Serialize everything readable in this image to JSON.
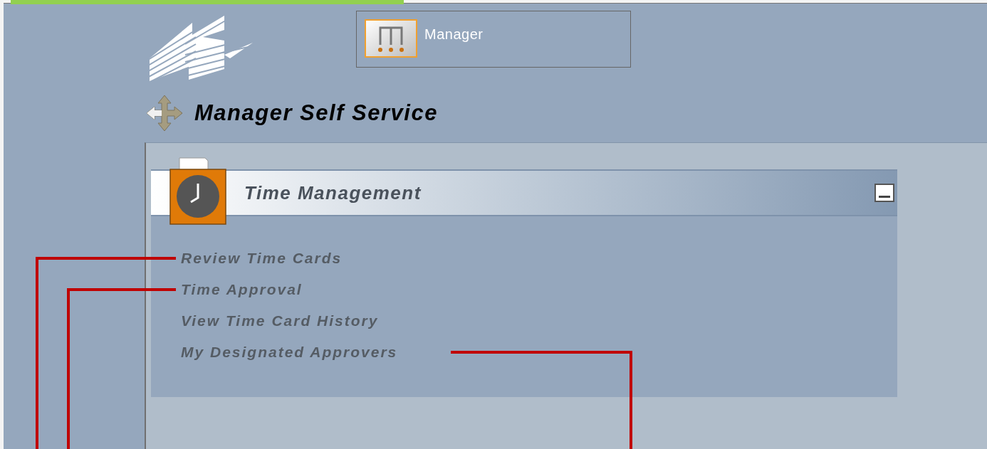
{
  "header": {
    "role_tab": {
      "label": "Manager"
    }
  },
  "page_title": "Manager Self Service",
  "section": {
    "title": "Time Management",
    "expanded": true,
    "links": [
      {
        "label": "Review Time Cards"
      },
      {
        "label": "Time Approval"
      },
      {
        "label": "View Time Card History"
      },
      {
        "label": "My Designated Approvers"
      }
    ]
  }
}
